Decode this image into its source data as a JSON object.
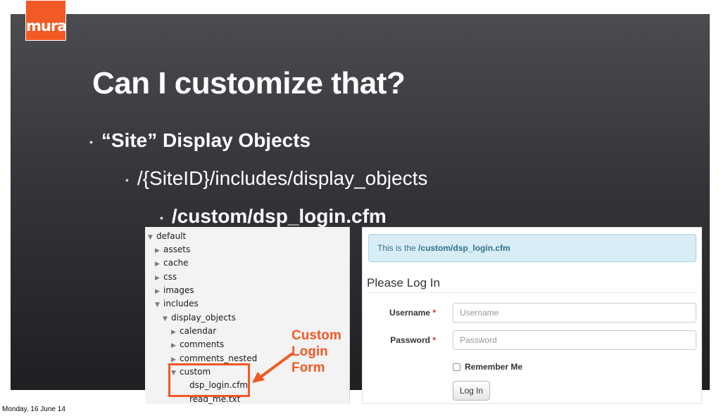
{
  "logo": {
    "text": "mura",
    "color": "#f15a24"
  },
  "slide": {
    "title": "Can I customize that?",
    "bullets": [
      "“Site” Display Objects",
      "/{SiteID}/includes/display_objects",
      "/custom/dsp_login.cfm"
    ]
  },
  "tree": {
    "items": [
      {
        "label": "default",
        "state": "expanded",
        "icon": "triangle-down-icon"
      },
      {
        "label": "assets",
        "state": "collapsed",
        "icon": "triangle-right-icon"
      },
      {
        "label": "cache",
        "state": "collapsed",
        "icon": "triangle-right-icon"
      },
      {
        "label": "css",
        "state": "collapsed",
        "icon": "triangle-right-icon"
      },
      {
        "label": "images",
        "state": "collapsed",
        "icon": "triangle-right-icon"
      },
      {
        "label": "includes",
        "state": "expanded",
        "icon": "triangle-down-icon"
      },
      {
        "label": "display_objects",
        "state": "expanded",
        "icon": "triangle-down-icon"
      },
      {
        "label": "calendar",
        "state": "collapsed",
        "icon": "triangle-right-icon"
      },
      {
        "label": "comments",
        "state": "collapsed",
        "icon": "triangle-right-icon"
      },
      {
        "label": "comments_nested",
        "state": "collapsed",
        "icon": "triangle-right-icon"
      },
      {
        "label": "custom",
        "state": "expanded",
        "icon": "triangle-down-icon"
      },
      {
        "label": "dsp_login.cfm",
        "state": "file",
        "icon": ""
      },
      {
        "label": "read_me.txt",
        "state": "file",
        "icon": ""
      }
    ]
  },
  "callout": {
    "lines": [
      "Custom",
      "Login",
      "Form"
    ],
    "color": "#f05a24"
  },
  "login": {
    "alert_prefix": "This is the ",
    "alert_path": "/custom/dsp_login.cfm",
    "heading": "Please Log In",
    "username_label": "Username",
    "username_placeholder": "Username",
    "password_label": "Password",
    "password_placeholder": "Password",
    "required_mark": "*",
    "remember_label": "Remember Me",
    "submit_label": "Log In"
  },
  "footer": {
    "date": "Monday, 16 June 14"
  }
}
